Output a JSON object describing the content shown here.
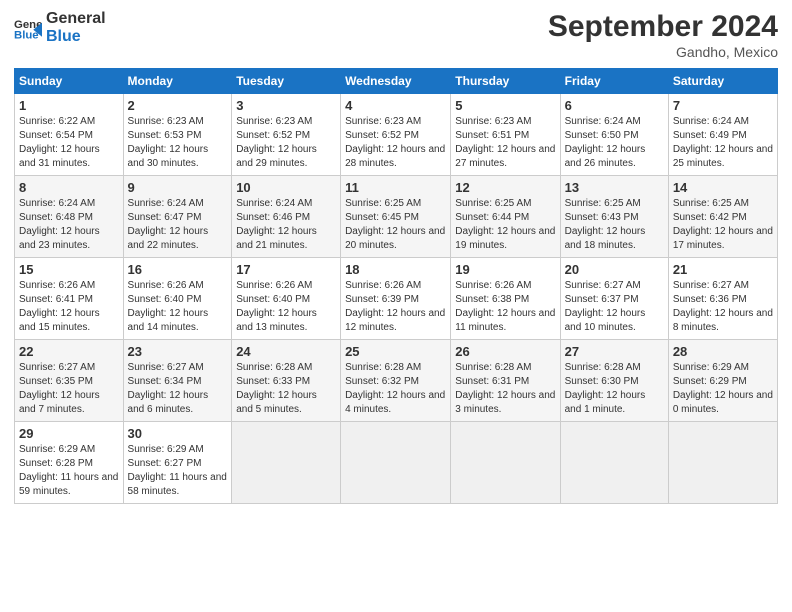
{
  "header": {
    "logo_line1": "General",
    "logo_line2": "Blue",
    "month": "September 2024",
    "location": "Gandho, Mexico"
  },
  "days_of_week": [
    "Sunday",
    "Monday",
    "Tuesday",
    "Wednesday",
    "Thursday",
    "Friday",
    "Saturday"
  ],
  "weeks": [
    [
      {
        "day": "1",
        "sunrise": "6:22 AM",
        "sunset": "6:54 PM",
        "daylight": "12 hours and 31 minutes."
      },
      {
        "day": "2",
        "sunrise": "6:23 AM",
        "sunset": "6:53 PM",
        "daylight": "12 hours and 30 minutes."
      },
      {
        "day": "3",
        "sunrise": "6:23 AM",
        "sunset": "6:52 PM",
        "daylight": "12 hours and 29 minutes."
      },
      {
        "day": "4",
        "sunrise": "6:23 AM",
        "sunset": "6:52 PM",
        "daylight": "12 hours and 28 minutes."
      },
      {
        "day": "5",
        "sunrise": "6:23 AM",
        "sunset": "6:51 PM",
        "daylight": "12 hours and 27 minutes."
      },
      {
        "day": "6",
        "sunrise": "6:24 AM",
        "sunset": "6:50 PM",
        "daylight": "12 hours and 26 minutes."
      },
      {
        "day": "7",
        "sunrise": "6:24 AM",
        "sunset": "6:49 PM",
        "daylight": "12 hours and 25 minutes."
      }
    ],
    [
      {
        "day": "8",
        "sunrise": "6:24 AM",
        "sunset": "6:48 PM",
        "daylight": "12 hours and 23 minutes."
      },
      {
        "day": "9",
        "sunrise": "6:24 AM",
        "sunset": "6:47 PM",
        "daylight": "12 hours and 22 minutes."
      },
      {
        "day": "10",
        "sunrise": "6:24 AM",
        "sunset": "6:46 PM",
        "daylight": "12 hours and 21 minutes."
      },
      {
        "day": "11",
        "sunrise": "6:25 AM",
        "sunset": "6:45 PM",
        "daylight": "12 hours and 20 minutes."
      },
      {
        "day": "12",
        "sunrise": "6:25 AM",
        "sunset": "6:44 PM",
        "daylight": "12 hours and 19 minutes."
      },
      {
        "day": "13",
        "sunrise": "6:25 AM",
        "sunset": "6:43 PM",
        "daylight": "12 hours and 18 minutes."
      },
      {
        "day": "14",
        "sunrise": "6:25 AM",
        "sunset": "6:42 PM",
        "daylight": "12 hours and 17 minutes."
      }
    ],
    [
      {
        "day": "15",
        "sunrise": "6:26 AM",
        "sunset": "6:41 PM",
        "daylight": "12 hours and 15 minutes."
      },
      {
        "day": "16",
        "sunrise": "6:26 AM",
        "sunset": "6:40 PM",
        "daylight": "12 hours and 14 minutes."
      },
      {
        "day": "17",
        "sunrise": "6:26 AM",
        "sunset": "6:40 PM",
        "daylight": "12 hours and 13 minutes."
      },
      {
        "day": "18",
        "sunrise": "6:26 AM",
        "sunset": "6:39 PM",
        "daylight": "12 hours and 12 minutes."
      },
      {
        "day": "19",
        "sunrise": "6:26 AM",
        "sunset": "6:38 PM",
        "daylight": "12 hours and 11 minutes."
      },
      {
        "day": "20",
        "sunrise": "6:27 AM",
        "sunset": "6:37 PM",
        "daylight": "12 hours and 10 minutes."
      },
      {
        "day": "21",
        "sunrise": "6:27 AM",
        "sunset": "6:36 PM",
        "daylight": "12 hours and 8 minutes."
      }
    ],
    [
      {
        "day": "22",
        "sunrise": "6:27 AM",
        "sunset": "6:35 PM",
        "daylight": "12 hours and 7 minutes."
      },
      {
        "day": "23",
        "sunrise": "6:27 AM",
        "sunset": "6:34 PM",
        "daylight": "12 hours and 6 minutes."
      },
      {
        "day": "24",
        "sunrise": "6:28 AM",
        "sunset": "6:33 PM",
        "daylight": "12 hours and 5 minutes."
      },
      {
        "day": "25",
        "sunrise": "6:28 AM",
        "sunset": "6:32 PM",
        "daylight": "12 hours and 4 minutes."
      },
      {
        "day": "26",
        "sunrise": "6:28 AM",
        "sunset": "6:31 PM",
        "daylight": "12 hours and 3 minutes."
      },
      {
        "day": "27",
        "sunrise": "6:28 AM",
        "sunset": "6:30 PM",
        "daylight": "12 hours and 1 minute."
      },
      {
        "day": "28",
        "sunrise": "6:29 AM",
        "sunset": "6:29 PM",
        "daylight": "12 hours and 0 minutes."
      }
    ],
    [
      {
        "day": "29",
        "sunrise": "6:29 AM",
        "sunset": "6:28 PM",
        "daylight": "11 hours and 59 minutes."
      },
      {
        "day": "30",
        "sunrise": "6:29 AM",
        "sunset": "6:27 PM",
        "daylight": "11 hours and 58 minutes."
      },
      null,
      null,
      null,
      null,
      null
    ]
  ]
}
